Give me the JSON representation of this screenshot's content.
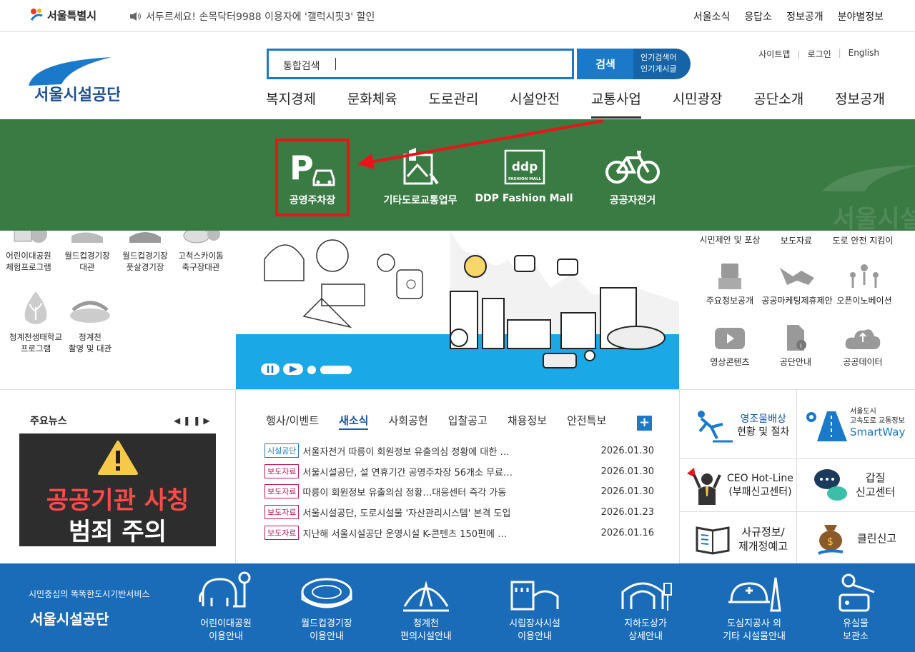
{
  "topbar": {
    "city_name": "서울특별시",
    "notice": "서두르세요! 손목닥터9988 이용자에 '갤럭시핏3' 할인",
    "links": [
      "서울소식",
      "응답소",
      "정보공개",
      "분야별정보"
    ]
  },
  "header": {
    "logo_text": "서울시설공단",
    "search_placeholder": "통합검색",
    "search_button": "검색",
    "popular_search": "인기검색어",
    "popular_posts": "인기게시글",
    "util_links": [
      "사이트맵",
      "로그인",
      "English"
    ]
  },
  "gnb": [
    "복지경제",
    "문화체육",
    "도로관리",
    "시설안전",
    "교통사업",
    "시민광장",
    "공단소개",
    "정보공개"
  ],
  "gnb_active": "교통사업",
  "submenu": {
    "items": [
      "공영주차장",
      "기타도로교통업무",
      "DDP Fashion Mall",
      "공공자전거"
    ],
    "ddp_logo": "ddp",
    "ddp_small": "FASHION MALL",
    "watermark": "서울시설"
  },
  "left_quick": [
    {
      "label": "어린이대공원\n체험프로그램"
    },
    {
      "label": "월드컵경기장\n대관"
    },
    {
      "label": "월드컵경기장\n풋살경기장"
    },
    {
      "label": "고척스카이돔\n축구장대관"
    },
    {
      "label": "청계천생태학교\n프로그램"
    },
    {
      "label": "청계천\n촬영 및 대관"
    }
  ],
  "right_quick": [
    "시민제안 및 포상",
    "보도자료",
    "도로 안전 지킴이",
    "주요정보공개",
    "공공마케팅제휴제안",
    "오픈이노베이션",
    "영상콘텐츠",
    "공단안내",
    "공공데이터"
  ],
  "news": {
    "title": "주요뉴스",
    "banner_line1": "공공기관 사칭",
    "banner_line2": "범죄 주의"
  },
  "board": {
    "tabs": [
      "행사/이벤트",
      "새소식",
      "사회공헌",
      "입찰공고",
      "채용정보",
      "안전특보"
    ],
    "active_tab": "새소식",
    "plus": "+",
    "rows": [
      {
        "badge": "시설공단",
        "title": "서울자전거 따릉이 회원정보 유출의심 정황에 대한 …",
        "date": "2026.01.30"
      },
      {
        "badge": "보도자료",
        "title": "서울시설공단, 설 연휴기간 공영주차장 56개소 무료…",
        "date": "2026.01.30"
      },
      {
        "badge": "보도자료",
        "title": "따릉이 회원정보 유출의심 정황…대응센터 즉각 가동",
        "date": "2026.01.30"
      },
      {
        "badge": "보도자료",
        "title": "서울시설공단, 도로시설물 '자산관리시스템' 본격 도입",
        "date": "2026.01.23"
      },
      {
        "badge": "보도자료",
        "title": "지난해 서울시설공단 운영시설 K-콘텐츠 150편에 …",
        "date": "2026.01.16"
      }
    ]
  },
  "right_boxes": {
    "damage_l1": "영조물배상",
    "damage_l2": "현황 및 절차",
    "smartway_l1": "서울도시",
    "smartway_l2": "고속도로 교통정보",
    "smartway_l3": "SmartWay",
    "ceo_l1": "CEO Hot-Line",
    "ceo_l2": "(부패신고센터)",
    "gapjil_l1": "갑질",
    "gapjil_l2": "신고센터",
    "regul_l1": "사규정보/",
    "regul_l2": "제개정예고",
    "clean": "클린신고"
  },
  "footer": {
    "tagline": "시민중심의 똑똑한도시기반서비스",
    "logo_text": "서울시설공단",
    "items": [
      "어린이대공원\n이용안내",
      "월드컵경기장\n이용안내",
      "청계천\n편의시설안내",
      "시립장사시설\n이용안내",
      "지하도상가\n상세안내",
      "도심지공사 외\n기타 시설물안내",
      "유실물\n보관소"
    ]
  },
  "colors": {
    "green": "#3a7a43",
    "blue": "#1a79c9",
    "red": "#e8141a",
    "footer": "#1a6bb8"
  }
}
